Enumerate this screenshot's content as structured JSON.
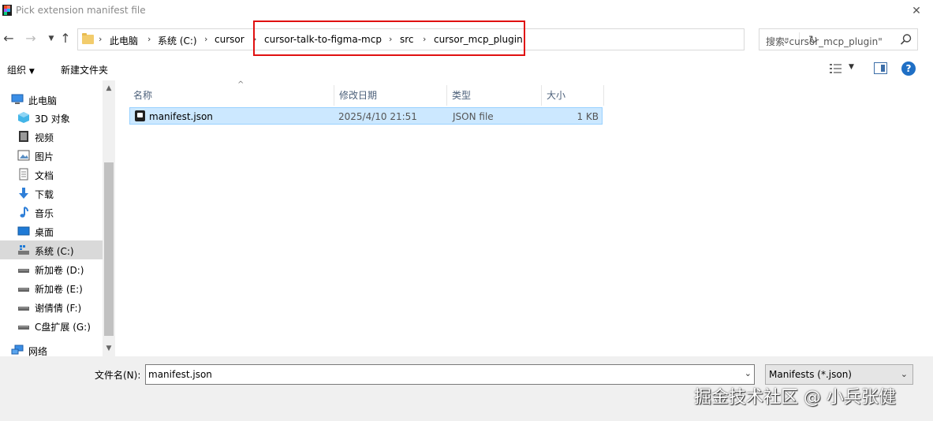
{
  "window": {
    "title": "Pick extension manifest file"
  },
  "breadcrumbs": [
    "此电脑",
    "系统 (C:)",
    "cursor",
    "cursor-talk-to-figma-mcp",
    "src",
    "cursor_mcp_plugin"
  ],
  "search": {
    "placeholder": "搜索\"cursor_mcp_plugin\""
  },
  "toolbar": {
    "organize": "组织",
    "new_folder": "新建文件夹"
  },
  "sidebar": {
    "items": [
      {
        "label": "此电脑",
        "icon": "computer-icon"
      },
      {
        "label": "3D 对象",
        "icon": "cube-icon"
      },
      {
        "label": "视频",
        "icon": "video-icon"
      },
      {
        "label": "图片",
        "icon": "picture-icon"
      },
      {
        "label": "文档",
        "icon": "document-icon"
      },
      {
        "label": "下载",
        "icon": "download-icon"
      },
      {
        "label": "音乐",
        "icon": "music-icon"
      },
      {
        "label": "桌面",
        "icon": "desktop-icon"
      },
      {
        "label": "系统 (C:)",
        "icon": "drive-icon"
      },
      {
        "label": "新加卷 (D:)",
        "icon": "drive-icon"
      },
      {
        "label": "新加卷 (E:)",
        "icon": "drive-icon"
      },
      {
        "label": "谢倩倩 (F:)",
        "icon": "drive-icon"
      },
      {
        "label": "C盘扩展 (G:)",
        "icon": "drive-icon"
      },
      {
        "label": "网络",
        "icon": "network-icon"
      }
    ]
  },
  "columns": {
    "name": "名称",
    "modified": "修改日期",
    "type": "类型",
    "size": "大小"
  },
  "files": [
    {
      "name": "manifest.json",
      "modified": "2025/4/10 21:51",
      "type": "JSON file",
      "size": "1 KB"
    }
  ],
  "bottom": {
    "filename_label": "文件名(N):",
    "filename_value": "manifest.json",
    "filetype_value": "Manifests (*.json)"
  },
  "watermark": "掘金技术社区 @ 小兵张健",
  "colors": {
    "selection": "#cce8ff",
    "highlight_box": "#e01010",
    "accent": "#1f6fc5"
  }
}
